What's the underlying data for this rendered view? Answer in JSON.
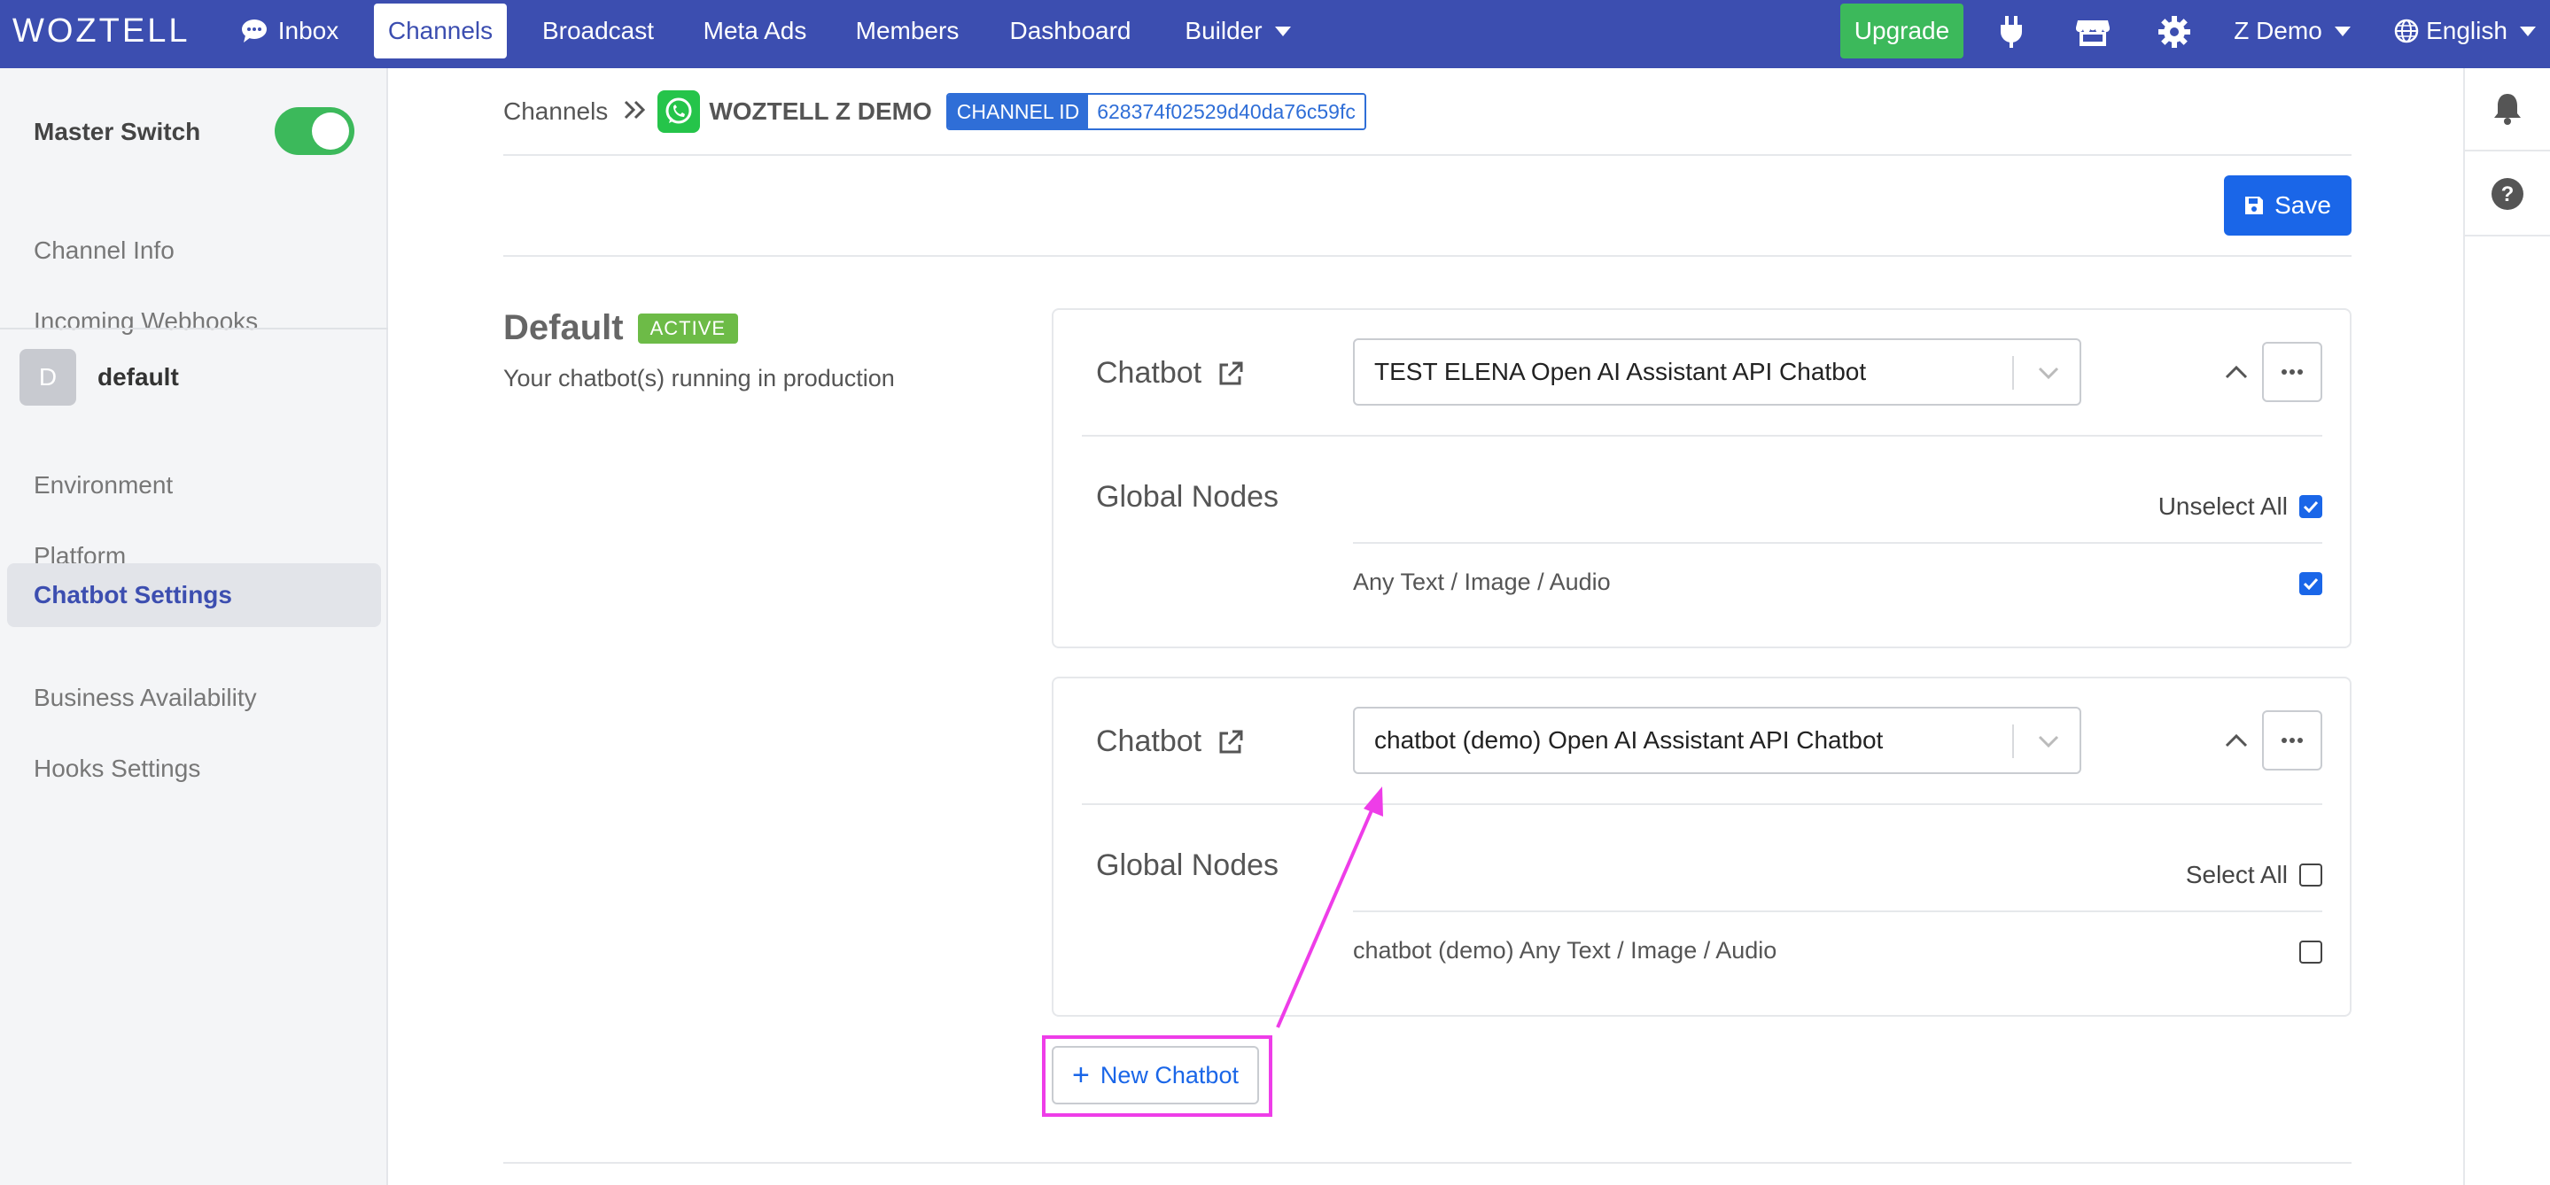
{
  "nav": {
    "brand": "WOZTELL",
    "items": [
      {
        "label": "Inbox"
      },
      {
        "label": "Channels"
      },
      {
        "label": "Broadcast"
      },
      {
        "label": "Meta Ads"
      },
      {
        "label": "Members"
      },
      {
        "label": "Dashboard"
      },
      {
        "label": "Builder"
      }
    ],
    "upgrade": "Upgrade",
    "user": "Z Demo",
    "language": "English",
    "colors": {
      "bar": "#3c4eb0",
      "upgrade": "#3cb95b"
    }
  },
  "sidebar": {
    "master_switch": "Master Switch",
    "master_switch_on": true,
    "items_top": [
      {
        "label": "Channel Info"
      },
      {
        "label": "Incoming Webhooks"
      }
    ],
    "environment": {
      "avatar": "D",
      "name": "default"
    },
    "items_env": [
      {
        "label": "Environment"
      },
      {
        "label": "Platform"
      },
      {
        "label": "Chatbot Settings"
      },
      {
        "label": "Business Availability"
      },
      {
        "label": "Hooks Settings"
      }
    ]
  },
  "breadcrumb": {
    "root": "Channels",
    "channel": "WOZTELL Z DEMO",
    "channel_id_label": "CHANNEL ID",
    "channel_id": "628374f02529d40da76c59fc"
  },
  "save_label": "Save",
  "section": {
    "title": "Default",
    "badge": "ACTIVE",
    "description": "Your chatbot(s) running in production"
  },
  "cards": [
    {
      "label": "Chatbot",
      "selected": "TEST ELENA Open AI Assistant API Chatbot",
      "global_nodes_label": "Global Nodes",
      "select_toggle": "Unselect All",
      "select_toggle_checked": true,
      "nodes": [
        {
          "label": "Any Text / Image / Audio",
          "checked": true
        }
      ]
    },
    {
      "label": "Chatbot",
      "selected": "chatbot (demo) Open AI Assistant API Chatbot",
      "global_nodes_label": "Global Nodes",
      "select_toggle": "Select All",
      "select_toggle_checked": false,
      "nodes": [
        {
          "label": "chatbot (demo) Any Text / Image / Audio",
          "checked": false
        }
      ]
    }
  ],
  "new_chatbot_label": "New Chatbot",
  "annotation_color": "#ee3de8"
}
